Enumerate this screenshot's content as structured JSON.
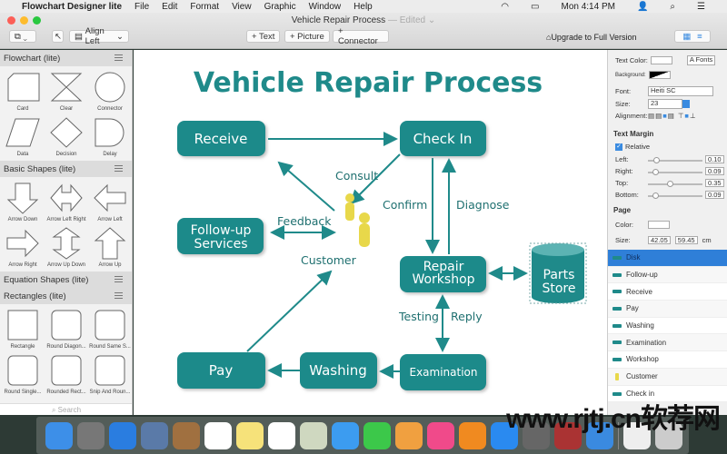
{
  "menubar": {
    "app": "Flowchart Designer lite",
    "items": [
      "File",
      "Edit",
      "Format",
      "View",
      "Graphic",
      "Window",
      "Help"
    ],
    "clock": "Mon 4:14 PM"
  },
  "window": {
    "title": "Vehicle Repair Process",
    "edited": "— Edited ⌄"
  },
  "toolbar": {
    "align": "Align Left",
    "text": "+ Text",
    "picture": "+ Picture",
    "connector": "+ Connector",
    "upgrade": "Upgrade to Full Version"
  },
  "sidebar": {
    "sections": [
      {
        "title": "Flowchart (lite)",
        "items": [
          "Card",
          "Clear",
          "Connector",
          "Data",
          "Decision",
          "Delay"
        ]
      },
      {
        "title": "Basic Shapes (lite)",
        "items": [
          "Arrow Down",
          "Arrow Left Right",
          "Arrow Left",
          "Arrow Right",
          "Arrow Up Down",
          "Arrow Up"
        ]
      },
      {
        "title": "Equation Shapes (lite)",
        "items": []
      },
      {
        "title": "Rectangles (lite)",
        "items": [
          "Rectangle",
          "Round Diagon...",
          "Round Same S...",
          "Round Single...",
          "Rounded Rect...",
          "Snip And Roun..."
        ]
      }
    ],
    "search_placeholder": "Search"
  },
  "diagram": {
    "title": "Vehicle Repair Process",
    "color": "#1f8a8a",
    "nodes": {
      "receive": "Receive",
      "checkin": "Check In",
      "followup1": "Follow-up",
      "followup2": "Services",
      "repair1": "Repair",
      "repair2": "Workshop",
      "parts1": "Parts",
      "parts2": "Store",
      "pay": "Pay",
      "washing": "Washing",
      "exam": "Examination"
    },
    "labels": {
      "consult": "Consult",
      "confirm": "Confirm",
      "diagnose": "Diagnose",
      "feedback": "Feedback",
      "customer": "Customer",
      "testing": "Testing",
      "reply": "Reply"
    }
  },
  "inspector": {
    "text_color": "Text Color:",
    "fonts": "A  Fonts",
    "background": "Background:",
    "font_label": "Font:",
    "font": "Heiti SC",
    "size_label": "Size:",
    "size": "23",
    "alignment": "Alignment:",
    "text_margin": "Text Margin",
    "relative": "Relative",
    "relative_checked": true,
    "margins": [
      {
        "label": "Left:",
        "value": "0.10"
      },
      {
        "label": "Right:",
        "value": "0.09"
      },
      {
        "label": "Top:",
        "value": "0.35"
      },
      {
        "label": "Bottom:",
        "value": "0.09"
      }
    ],
    "page": "Page",
    "color_label": "Color:",
    "page_size_label": "Size:",
    "width": "42.05",
    "height": "59.45",
    "unit": "cm"
  },
  "layers": [
    "Disk",
    "Follow-up",
    "Receive",
    "Pay",
    "Washing",
    "Examination",
    "Workshop",
    "Customer",
    "Check in"
  ],
  "selected_layer": "Disk",
  "watermark": "www.rjtj.cn软荐网"
}
